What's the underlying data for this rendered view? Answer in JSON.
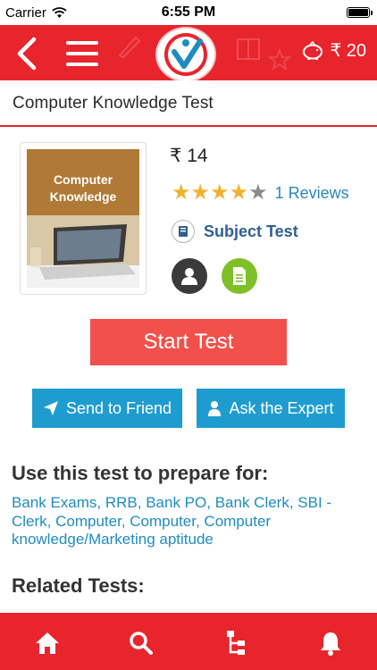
{
  "status_bar": {
    "carrier": "Carrier",
    "time": "6:55 PM"
  },
  "header": {
    "wallet_amount": "₹ 20",
    "brand_color": "#e8242d"
  },
  "page": {
    "title": "Computer Knowledge Test"
  },
  "product": {
    "thumbnail_text": "Computer Knowledge",
    "price": "₹ 14",
    "rating": 4,
    "rating_max": 5,
    "reviews_label": "1 Reviews",
    "category_label": "Subject Test"
  },
  "actions": {
    "start_label": "Start Test",
    "send_label": "Send to Friend",
    "ask_label": "Ask the Expert"
  },
  "prepare": {
    "heading": "Use this test to prepare for:",
    "text": "Bank Exams, RRB, Bank PO, Bank Clerk, SBI - Clerk, Computer, Computer, Computer knowledge/Marketing aptitude"
  },
  "related": {
    "heading": "Related Tests:"
  },
  "colors": {
    "accent": "#e8242d",
    "start_button": "#f2514b",
    "action_button": "#1f9ccf",
    "link": "#2a86bf",
    "star": "#f2b12f"
  },
  "icons": [
    "wifi-icon",
    "back-icon",
    "menu-icon",
    "piggy-bank-icon",
    "book-icon",
    "user-icon",
    "document-icon",
    "send-icon",
    "person-icon",
    "home-icon",
    "search-icon",
    "tree-icon",
    "bell-icon"
  ]
}
